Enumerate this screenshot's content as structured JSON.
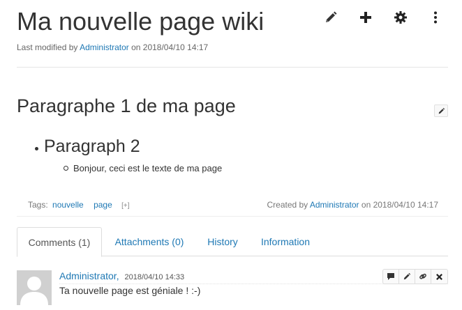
{
  "page": {
    "title": "Ma nouvelle page wiki",
    "last_modified_prefix": "Last modified by",
    "last_modified_user": "Administrator",
    "last_modified_on": "on 2018/04/10 14:17"
  },
  "toolbar": {
    "icons": [
      "edit-icon",
      "add-icon",
      "gear-icon",
      "more-vertical-icon"
    ]
  },
  "content": {
    "heading": "Paragraphe 1 de ma page",
    "bullet_level1": "Paragraph 2",
    "bullet_level2": "Bonjour, ceci est le texte de ma page"
  },
  "tags": {
    "label": "Tags:",
    "items": [
      "nouvelle",
      "page"
    ],
    "add_label": "[+]"
  },
  "created": {
    "prefix": "Created by",
    "user": "Administrator",
    "on": "on 2018/04/10 14:17"
  },
  "tabs": [
    {
      "label": "Comments (1)",
      "active": true
    },
    {
      "label": "Attachments (0)",
      "active": false
    },
    {
      "label": "History",
      "active": false
    },
    {
      "label": "Information",
      "active": false
    }
  ],
  "comment": {
    "author": "Administrator,",
    "date": "2018/04/10 14:33",
    "text": "Ta nouvelle page est géniale ! :-)",
    "actions": [
      "reply-icon",
      "edit-icon",
      "link-icon",
      "delete-icon"
    ]
  },
  "colors": {
    "link": "#1e78b4",
    "text": "#333333",
    "muted": "#777777"
  }
}
